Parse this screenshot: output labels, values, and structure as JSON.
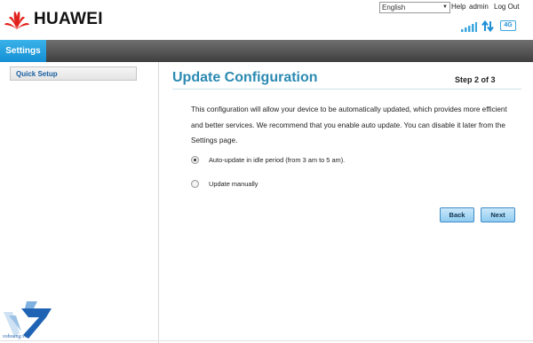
{
  "brand": {
    "name": "HUAWEI",
    "logo_color": "#e1211b"
  },
  "header": {
    "language": {
      "selected": "English"
    },
    "links": {
      "help": "Help",
      "user": "admin",
      "logout": "Log Out"
    },
    "status_icons": [
      "signal-strength-icon",
      "data-transfer-icon",
      "network-4g-icon"
    ],
    "network_type": "4G"
  },
  "nav": {
    "active_tab": "Settings",
    "accent": "#1f9fe0"
  },
  "sidebar": {
    "items": [
      {
        "label": "Quick Setup"
      }
    ]
  },
  "main": {
    "title": "Update Configuration",
    "step": "Step 2 of 3",
    "description": "This configuration will allow your device to be automatically updated, which provides more efficient and better services. We recommend that you enable auto update. You can disable it later from the Settings page.",
    "options": [
      {
        "label": "Auto-update in idle period (from 3 am to 5 am).",
        "selected": true
      },
      {
        "label": "Update manually",
        "selected": false
      }
    ],
    "buttons": {
      "back": "Back",
      "next": "Next"
    }
  },
  "watermark": {
    "text": "vohoang.vn"
  }
}
